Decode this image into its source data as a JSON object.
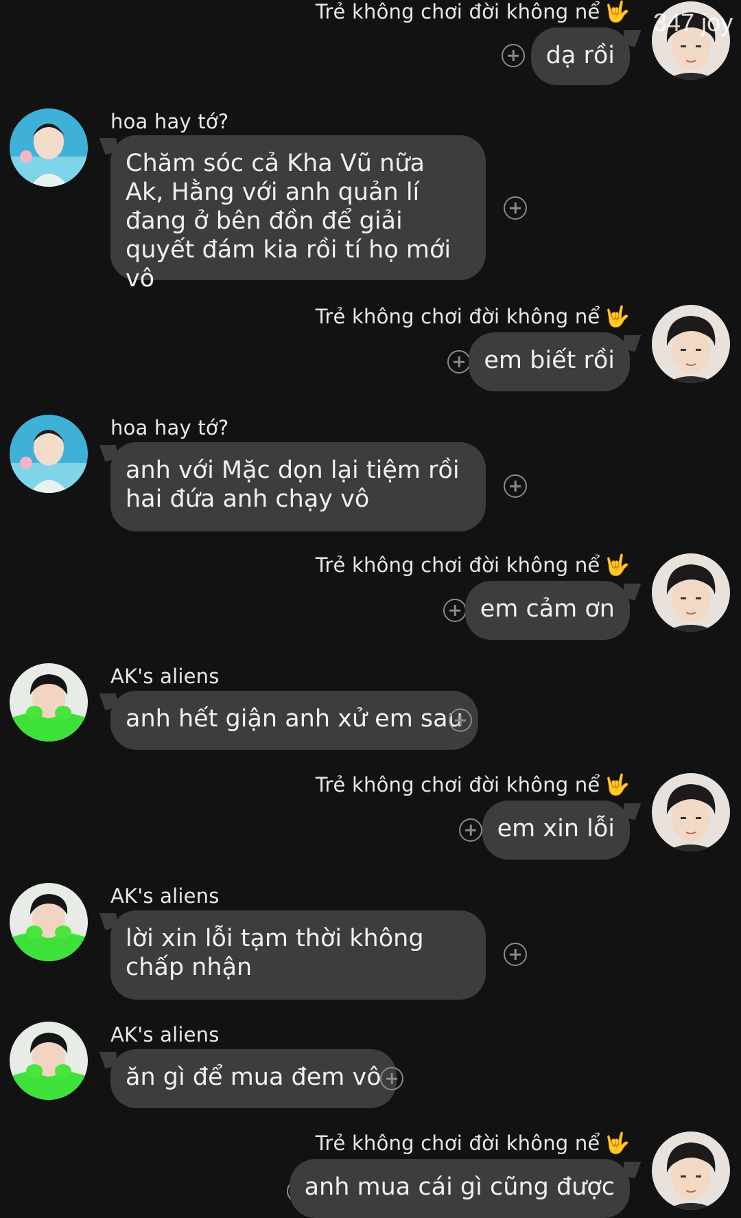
{
  "watermark": "347 joy",
  "messages": [
    {
      "type": "out",
      "sender": "Trẻ không chơi đời không nể",
      "sender_emoji": "🤟",
      "text": "dạ rồi"
    },
    {
      "type": "in",
      "sender": "hoa hay tớ?",
      "text": "Chăm sóc cả Kha Vũ nữa\nAk, Hằng với anh quản lí đang ở bên đồn để giải quyết đám kia rồi tí họ mới vô"
    },
    {
      "type": "out",
      "sender": "Trẻ không chơi đời không nể",
      "sender_emoji": "🤟",
      "text": "em biết rồi"
    },
    {
      "type": "in",
      "sender": "hoa hay tớ?",
      "text": "anh với Mặc dọn lại tiệm rồi hai đứa anh chạy vô"
    },
    {
      "type": "out",
      "sender": "Trẻ không chơi đời không nể",
      "sender_emoji": "🤟",
      "text": "em cảm ơn"
    },
    {
      "type": "in",
      "sender": "AK's aliens",
      "text": "anh hết giận anh xử em sau"
    },
    {
      "type": "out",
      "sender": "Trẻ không chơi đời không nể",
      "sender_emoji": "🤟",
      "text": "em xin lỗi"
    },
    {
      "type": "in",
      "sender": "AK's aliens",
      "text": "lời xin lỗi tạm thời không chấp nhận"
    },
    {
      "type": "in",
      "sender": "AK's aliens",
      "text": "ăn gì để mua đem vô"
    },
    {
      "type": "out",
      "sender": "Trẻ không chơi đời không nể",
      "sender_emoji": "🤟",
      "text": "anh mua cái gì cũng được"
    }
  ],
  "icons": {
    "react": "add-reaction-icon",
    "avatar_out": "avatar-boy-icon",
    "avatar_hoa": "avatar-pool-icon",
    "avatar_ak": "avatar-green-icon"
  }
}
